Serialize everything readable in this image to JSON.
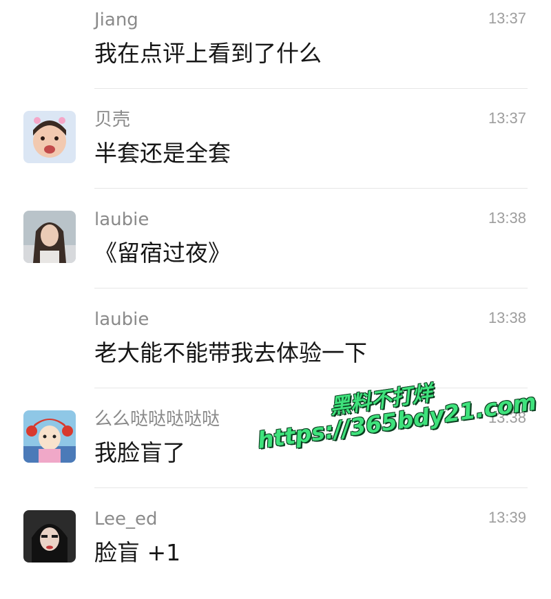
{
  "comments": [
    {
      "name": "Jiang",
      "time": "13:37",
      "text": "我在点评上看到了什么",
      "avatar": null
    },
    {
      "name": "贝壳",
      "time": "13:37",
      "text": "半套还是全套",
      "avatar": "girl-child-avatar"
    },
    {
      "name": "laubie",
      "time": "13:38",
      "text": "《留宿过夜》",
      "avatar": "woman-portrait-avatar"
    },
    {
      "name": "laubie",
      "time": "13:38",
      "text": "老大能不能带我去体验一下",
      "avatar": null
    },
    {
      "name": "么么哒哒哒哒哒",
      "time": "13:38",
      "text": "我脸盲了",
      "avatar": "cartoon-girl-avatar"
    },
    {
      "name": "Lee_ed",
      "time": "13:39",
      "text": "脸盲 +1",
      "avatar": "dark-portrait-avatar"
    }
  ],
  "watermark": {
    "line1": "黑料不打烊",
    "line2": "https://365bdy21.com",
    "color": "#3fe27c"
  }
}
